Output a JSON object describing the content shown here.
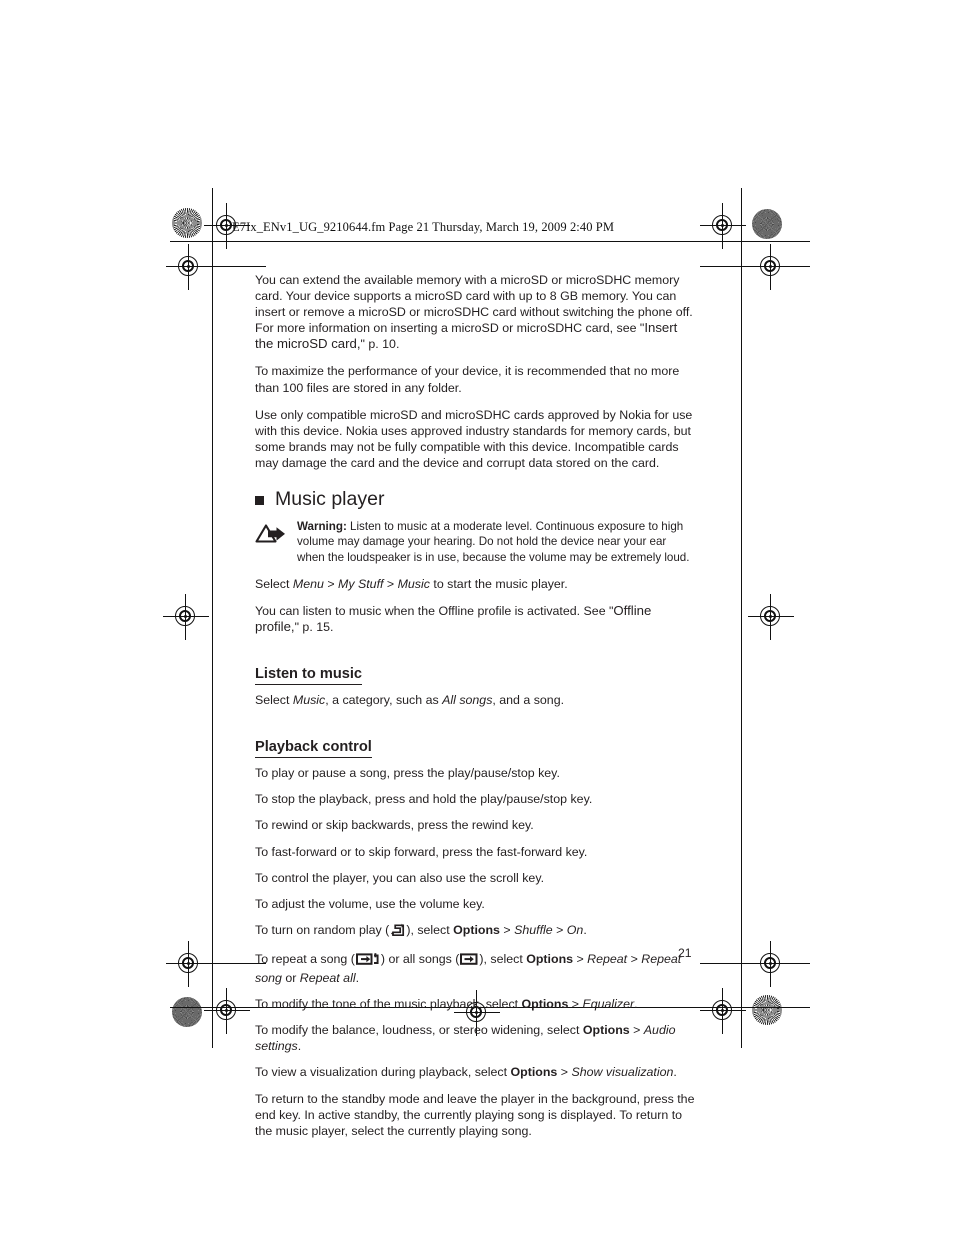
{
  "document": {
    "header_slug": "E7Ix_ENv1_UG_9210644.fm  Page 21  Thursday, March 19, 2009  2:40 PM",
    "page_number": "21"
  },
  "paragraphs": {
    "memory_card_1_a": "You can extend the available memory with a microSD or microSDHC memory card. Your device supports a microSD card with up to 8 GB memory. You can insert or remove a microSD or microSDHC card without switching the phone off. For more information on inserting a microSD or microSDHC card, see \"",
    "memory_card_1_ref": "Insert the microSD card,",
    "memory_card_1_b": "\" p. 10.",
    "memory_card_2": "To maximize the performance of your device, it is recommended that no more than 100 files are stored in any folder.",
    "memory_card_3": "Use only compatible microSD and microSDHC cards approved by Nokia for use with this device. Nokia uses approved industry standards for memory cards, but some brands may not be fully compatible with this device. Incompatible cards may damage the card and the device and corrupt data stored on the card."
  },
  "chapter": {
    "title": "Music player",
    "bullet": "square-bullet"
  },
  "warning": {
    "icon": "warning-triangle-arrow-icon",
    "label": "Warning:",
    "text": " Listen to music at a moderate level. Continuous exposure to high volume may damage your hearing. Do not hold the device near your ear when the loudspeaker is in use, because the volume may be extremely loud."
  },
  "intro": {
    "select_prefix": "Select ",
    "menu": "Menu",
    "sep1": " > ",
    "my_stuff": "My Stuff",
    "sep2": " > ",
    "music": "Music",
    "select_suffix": " to start the music player.",
    "offline_a": "You can listen to music when the Offline profile is activated. See \"",
    "offline_ref": "Offline profile,",
    "offline_b": "\" p. 15."
  },
  "sections": [
    {
      "heading": "Listen to music",
      "lines": [
        {
          "parts": [
            {
              "t": "Select ",
              "s": "normal"
            },
            {
              "t": "Music",
              "s": "italic"
            },
            {
              "t": ", a category, such as ",
              "s": "normal"
            },
            {
              "t": "All songs",
              "s": "italic"
            },
            {
              "t": ", and a song.",
              "s": "normal"
            }
          ]
        }
      ]
    },
    {
      "heading": "Playback control",
      "lines": [
        {
          "parts": [
            {
              "t": "To play or pause a song, press the play/pause/stop key.",
              "s": "normal"
            }
          ]
        },
        {
          "parts": [
            {
              "t": "To stop the playback, press and hold the play/pause/stop key.",
              "s": "normal"
            }
          ]
        },
        {
          "parts": [
            {
              "t": "To rewind or skip backwards, press the rewind key.",
              "s": "normal"
            }
          ]
        },
        {
          "parts": [
            {
              "t": "To fast-forward or to skip forward, press the fast-forward key.",
              "s": "normal"
            }
          ]
        },
        {
          "parts": [
            {
              "t": "To control the player, you can also use the scroll key.",
              "s": "normal"
            }
          ]
        },
        {
          "parts": [
            {
              "t": "To adjust the volume, use the volume key.",
              "s": "normal"
            }
          ]
        }
      ]
    }
  ],
  "playback_lines": {
    "shuffle": {
      "a": "To turn on random play (",
      "icon": "shuffle-icon",
      "b": "), select ",
      "options": "Options",
      "sep1": " > ",
      "shuffle_word": "Shuffle",
      "sep2": " > ",
      "on_word": "On",
      "end": "."
    },
    "repeat": {
      "a": "To repeat a song (",
      "icon_song": "repeat-song-icon",
      "b": ") or all songs (",
      "icon_all": "repeat-all-icon",
      "c": "), select ",
      "options": "Options",
      "sep1": " > ",
      "repeat_word": "Repeat",
      "sep2": " > ",
      "repeat_song": "Repeat song",
      "or_word": " or ",
      "repeat_all": "Repeat all",
      "end": "."
    },
    "equalizer": {
      "a": "To modify the tone of the music playback, select ",
      "options": "Options",
      "sep": " > ",
      "value": "Equalizer",
      "end": "."
    },
    "audio_settings": {
      "a": "To modify the balance, loudness, or stereo widening, select ",
      "options": "Options",
      "sep": " > ",
      "value": "Audio settings",
      "end": "."
    },
    "visualization": {
      "a": "To view a visualization during playback, select ",
      "options": "Options",
      "sep": " > ",
      "value": "Show visualization",
      "end": "."
    },
    "standby": "To return to the standby mode and leave the player in the background, press the end key. In active standby, the currently playing song is displayed. To return to the music player, select the currently playing song."
  }
}
